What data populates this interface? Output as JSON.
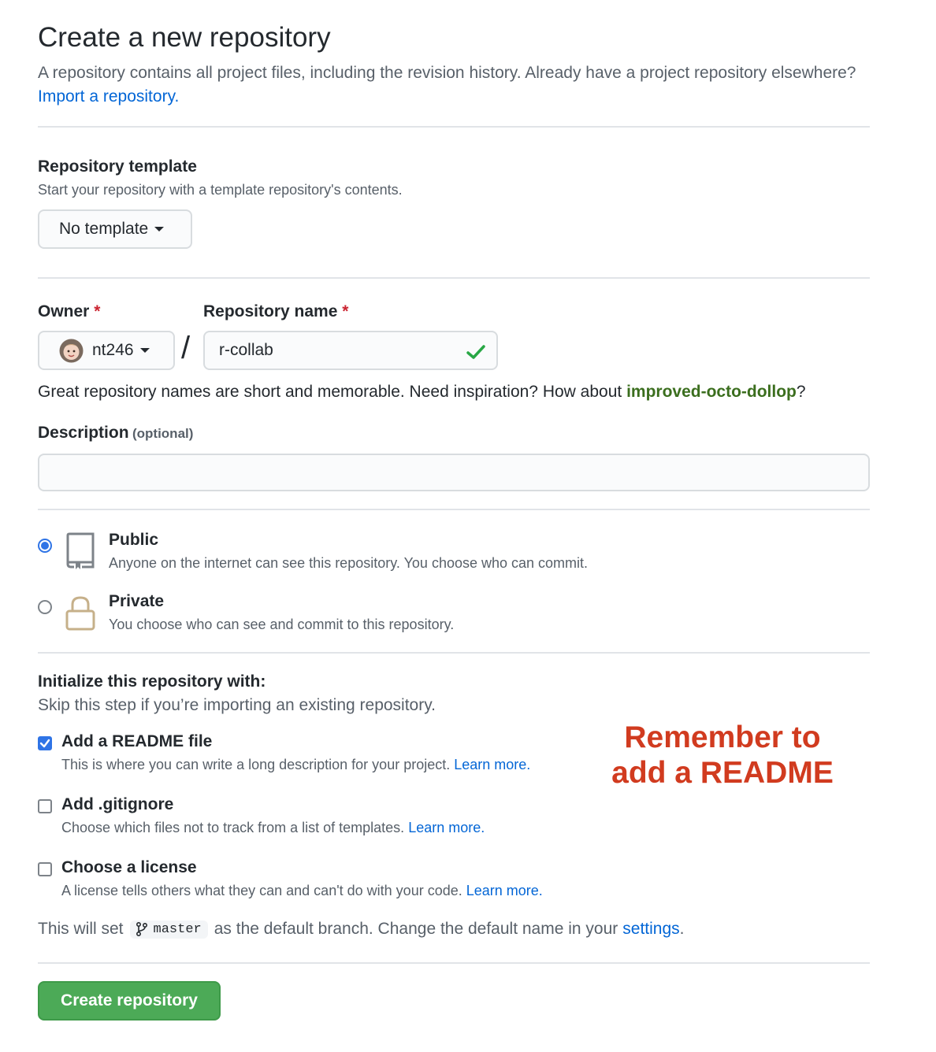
{
  "header": {
    "title": "Create a new repository",
    "lead": "A repository contains all project files, including the revision history. Already have a project repository elsewhere?",
    "import_link": "Import a repository."
  },
  "template": {
    "label": "Repository template",
    "note": "Start your repository with a template repository's contents.",
    "button": "No template"
  },
  "owner": {
    "label": "Owner",
    "required_mark": "*",
    "value": "nt246"
  },
  "separator": "/",
  "repo_name": {
    "label": "Repository name",
    "required_mark": "*",
    "value": "r-collab",
    "valid_icon": "check-icon"
  },
  "name_hint": {
    "text": "Great repository names are short and memorable. Need inspiration? How about",
    "suggestion": "improved-octo-dollop",
    "suffix": "?"
  },
  "description": {
    "label": "Description",
    "optional": "(optional)",
    "value": "",
    "placeholder": ""
  },
  "visibility": {
    "selected": "public",
    "public": {
      "label": "Public",
      "note": "Anyone on the internet can see this repository. You choose who can commit.",
      "icon": "repo-icon"
    },
    "private": {
      "label": "Private",
      "note": "You choose who can see and commit to this repository.",
      "icon": "lock-icon"
    }
  },
  "init": {
    "heading": "Initialize this repository with:",
    "note": "Skip this step if you’re importing an existing repository.",
    "readme": {
      "label": "Add a README file",
      "checked": true,
      "note": "This is where you can write a long description for your project.",
      "link": "Learn more."
    },
    "gitignore": {
      "label": "Add .gitignore",
      "checked": false,
      "note": "Choose which files not to track from a list of templates.",
      "link": "Learn more."
    },
    "license": {
      "label": "Choose a license",
      "checked": false,
      "note": "A license tells others what they can and can't do with your code.",
      "link": "Learn more."
    }
  },
  "annotation": {
    "line1": "Remember to",
    "line2": "add a README"
  },
  "branch": {
    "prefix": "This will set",
    "branch_name": "master",
    "middle": "as the default branch. Change the default name in your",
    "settings_link": "settings",
    "suffix": "."
  },
  "submit": {
    "label": "Create repository"
  },
  "colors": {
    "link": "#0366d6",
    "required": "#cb2431",
    "suggestion": "#3b6e1e",
    "valid_check": "#28a745",
    "primary_button": "#4caa57",
    "annotation": "#d13b1f",
    "radio_selected": "#2f74e6"
  }
}
